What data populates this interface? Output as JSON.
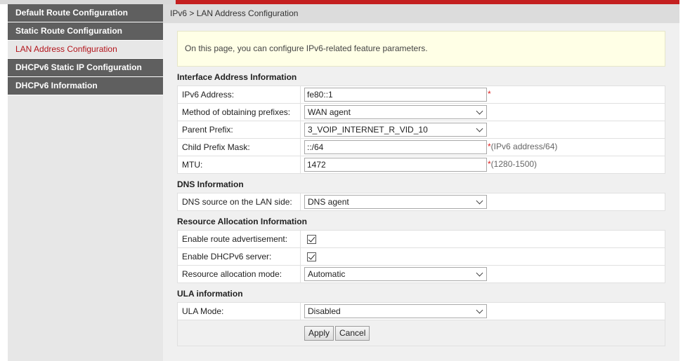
{
  "sidebar": {
    "items": [
      {
        "label": "Default Route Configuration"
      },
      {
        "label": "Static Route Configuration"
      },
      {
        "label": "LAN Address Configuration"
      },
      {
        "label": "DHCPv6 Static IP Configuration"
      },
      {
        "label": "DHCPv6 Information"
      }
    ],
    "active_index": 2
  },
  "breadcrumb": "IPv6 > LAN Address Configuration",
  "notice": "On this page, you can configure IPv6-related feature parameters.",
  "interface": {
    "title": "Interface Address Information",
    "ipv6_address": {
      "label": "IPv6 Address:",
      "value": "fe80::1",
      "required": "*"
    },
    "prefix_method": {
      "label": "Method of obtaining prefixes:",
      "value": "WAN agent"
    },
    "parent_prefix": {
      "label": "Parent Prefix:",
      "value": "3_VOIP_INTERNET_R_VID_10"
    },
    "child_prefix_mask": {
      "label": "Child Prefix Mask:",
      "value": "::/64",
      "required": "*",
      "hint": "(IPv6 address/64)"
    },
    "mtu": {
      "label": "MTU:",
      "value": "1472",
      "required": "*",
      "hint": "(1280-1500)"
    }
  },
  "dns": {
    "title": "DNS Information",
    "source": {
      "label": "DNS source on the LAN side:",
      "value": "DNS agent"
    }
  },
  "resource": {
    "title": "Resource Allocation Information",
    "route_adv": {
      "label": "Enable route advertisement:",
      "checked": true
    },
    "dhcpv6_server": {
      "label": "Enable DHCPv6 server:",
      "checked": true
    },
    "mode": {
      "label": "Resource allocation mode:",
      "value": "Automatic"
    }
  },
  "ula": {
    "title": "ULA information",
    "mode": {
      "label": "ULA Mode:",
      "value": "Disabled"
    }
  },
  "buttons": {
    "apply": "Apply",
    "cancel": "Cancel"
  },
  "colors": {
    "accent": "#c41f1f",
    "active_nav": "#b3141b",
    "nav_bg": "#5f5f5f",
    "required": "#e02020"
  }
}
